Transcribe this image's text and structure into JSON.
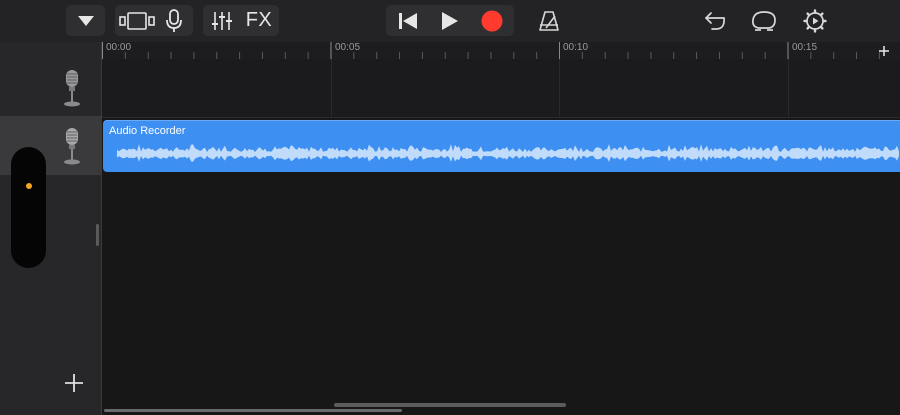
{
  "toolbar": {
    "fx_label": "FX",
    "icons": [
      "browser-dropdown-icon",
      "tracks-view-icon",
      "microphone-icon",
      "mixer-sliders-icon",
      "fx-button",
      "rewind-icon",
      "play-icon",
      "record-icon",
      "metronome-icon",
      "undo-icon",
      "loop-icon",
      "settings-gear-icon"
    ],
    "record_color": "#ff3b30"
  },
  "ruler": {
    "markers": [
      "00:00",
      "00:05",
      "00:10",
      "00:15"
    ]
  },
  "tracks": [
    {
      "instrument": "microphone",
      "selected": false
    },
    {
      "instrument": "microphone",
      "selected": true
    }
  ],
  "region": {
    "title": "Audio Recorder",
    "color": "#3d8ff2"
  },
  "colors": {
    "accent_dot": "#f5a623",
    "background": "#171718"
  }
}
